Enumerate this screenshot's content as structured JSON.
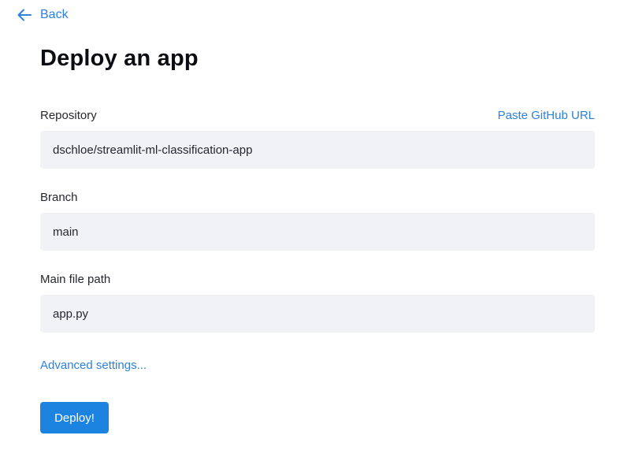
{
  "nav": {
    "back_label": "Back",
    "back_icon": "arrow-left-icon"
  },
  "page": {
    "title": "Deploy an app"
  },
  "form": {
    "repository": {
      "label": "Repository",
      "value": "dschloe/streamlit-ml-classification-app",
      "paste_link": "Paste GitHub URL"
    },
    "branch": {
      "label": "Branch",
      "value": "main"
    },
    "main_file": {
      "label": "Main file path",
      "value": "app.py"
    },
    "advanced_link": "Advanced settings...",
    "deploy_label": "Deploy!"
  },
  "colors": {
    "accent": "#1c83e1",
    "link": "#2b80e0",
    "input_bg": "#f0f2f6"
  }
}
